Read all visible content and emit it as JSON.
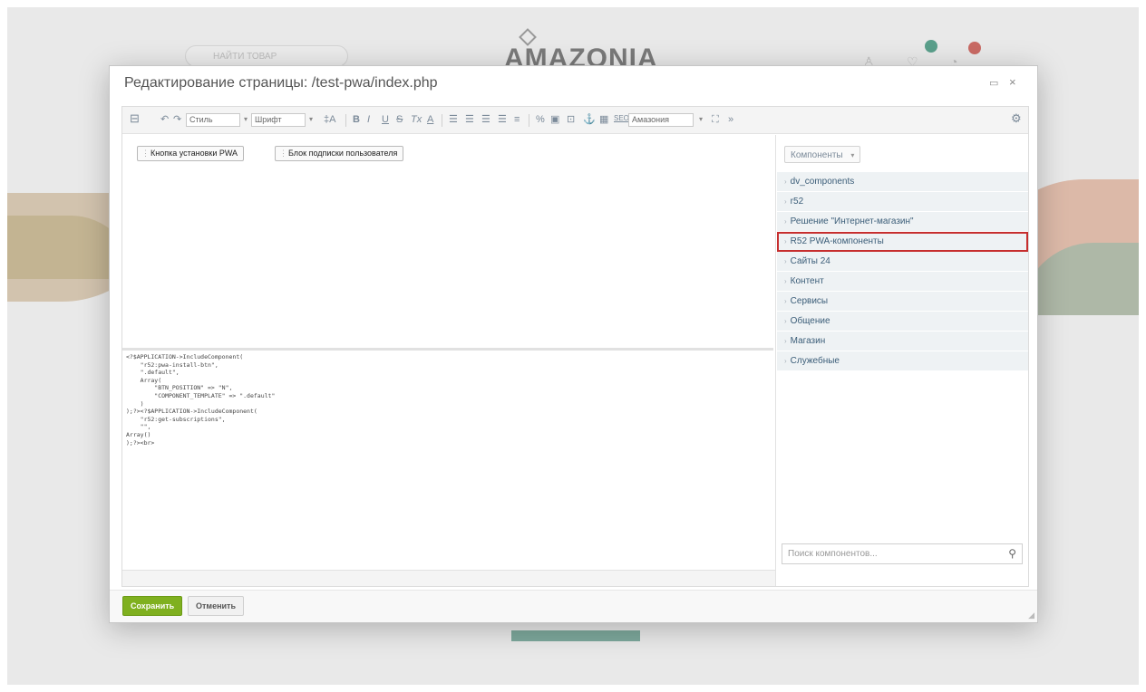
{
  "background": {
    "search_placeholder": "НАЙТИ ТОВАР",
    "logo_text": "AMAZONIA"
  },
  "modal": {
    "title": "Редактирование страницы: /test-pwa/index.php",
    "maximize_icon": "maximize-icon",
    "close_icon": "close-icon"
  },
  "toolbar": {
    "style_select": "Стиль",
    "font_select": "Шрифт",
    "template_select": "Амазония",
    "seo_label": "SEO",
    "font_size_label": "‡A"
  },
  "visual": {
    "components": [
      {
        "label": "Кнопка установки PWA"
      },
      {
        "label": "Блок подписки пользователя"
      }
    ]
  },
  "code": {
    "lines": [
      "<?$APPLICATION->IncludeComponent(",
      "    \"r52:pwa-install-btn\",",
      "    \".default\",",
      "    Array(",
      "        \"BTN_POSITION\" => \"N\",",
      "        \"COMPONENT_TEMPLATE\" => \".default\"",
      "    )",
      ");?><?$APPLICATION->IncludeComponent(",
      "    \"r52:get-subscriptions\",",
      "    \"\",",
      "Array()",
      ");?><br>"
    ]
  },
  "side_panel": {
    "header": "Компоненты",
    "tree": [
      {
        "label": "dv_components"
      },
      {
        "label": "r52"
      },
      {
        "label": "Решение \"Интернет-магазин\""
      },
      {
        "label": "R52 PWA-компоненты"
      },
      {
        "label": "Сайты 24"
      },
      {
        "label": "Контент"
      },
      {
        "label": "Сервисы"
      },
      {
        "label": "Общение"
      },
      {
        "label": "Магазин"
      },
      {
        "label": "Служебные"
      }
    ],
    "highlighted_index": 3,
    "highlight_color": "#c62e2e",
    "search_placeholder": "Поиск компонентов..."
  },
  "footer": {
    "save_label": "Сохранить",
    "cancel_label": "Отменить",
    "save_color": "#7fb01f"
  }
}
